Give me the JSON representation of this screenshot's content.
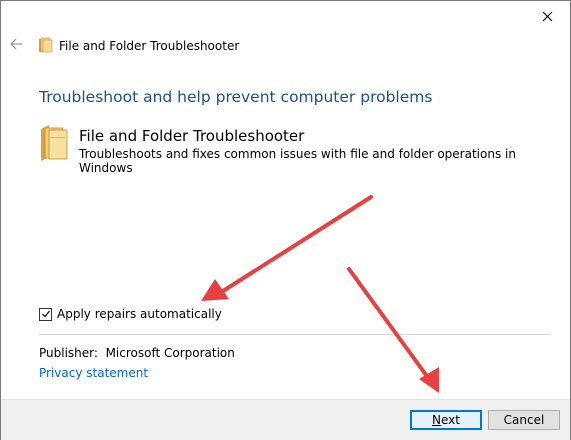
{
  "window": {
    "title": "File and Folder Troubleshooter",
    "close_icon": "close-icon",
    "back_icon": "back-arrow-icon"
  },
  "main": {
    "heading": "Troubleshoot and help prevent computer problems",
    "tool_name": "File and Folder Troubleshooter",
    "tool_description": "Troubleshoots and fixes common issues with file and folder operations in Windows",
    "apply_repairs_label": "Apply repairs automatically",
    "apply_repairs_checked": true,
    "publisher_label": "Publisher:",
    "publisher_value": "Microsoft Corporation",
    "privacy_link": "Privacy statement"
  },
  "footer": {
    "next_label_underlined": "N",
    "next_label_rest": "ext",
    "cancel_label": "Cancel"
  },
  "colors": {
    "heading": "#1e4f8f",
    "link": "#0066cc",
    "annotation_arrow": "#e84040",
    "default_button_border": "#0078d7"
  }
}
